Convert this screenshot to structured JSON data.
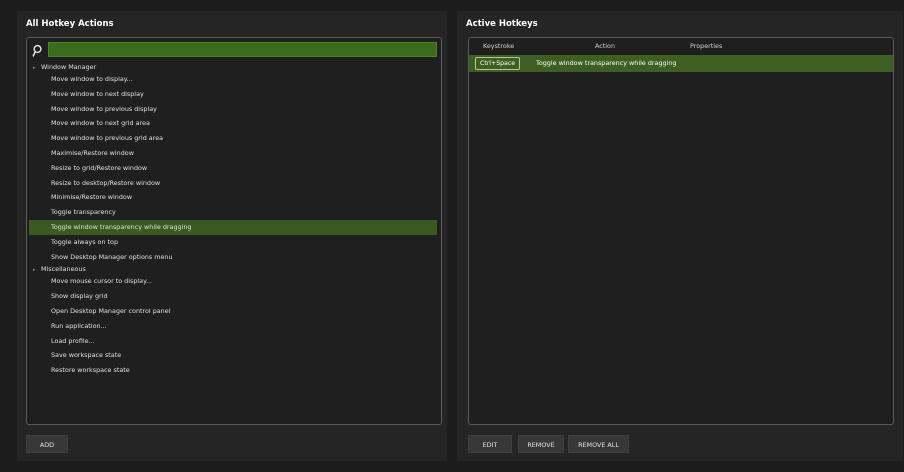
{
  "left_panel": {
    "title": "All Hotkey Actions",
    "groups": [
      {
        "label": "Window Manager",
        "items": [
          "Move window to display...",
          "Move window to next display",
          "Move window to previous display",
          "Move window to next grid area",
          "Move window to previous grid area",
          "Maximise/Restore window",
          "Resize to grid/Restore window",
          "Resize to desktop/Restore window",
          "Minimise/Restore window",
          "Toggle transparency",
          "Toggle window transparency while dragging",
          "Toggle always on top",
          "Show Desktop Manager options menu"
        ]
      },
      {
        "label": "Miscellaneous",
        "items": [
          "Move mouse cursor to display...",
          "Show display grid",
          "Open Desktop Manager control panel",
          "Run application...",
          "Load profile...",
          "Save workspace state",
          "Restore workspace state"
        ]
      }
    ],
    "selected_item": "Toggle window transparency while dragging",
    "add_label": "ADD"
  },
  "right_panel": {
    "title": "Active Hotkeys",
    "columns": [
      "Keystroke",
      "Action",
      "Properties"
    ],
    "rows": [
      {
        "keystroke": "Ctrl+Space",
        "action": "Toggle window transparency while dragging",
        "properties": ""
      }
    ],
    "edit_label": "EDIT",
    "remove_label": "REMOVE",
    "remove_all_label": "REMOVE ALL"
  },
  "icons": {
    "search": "search-icon"
  },
  "colors": {
    "accent": "#3d6b1c",
    "selection": "#3a5a22",
    "background": "#1b1b1b"
  }
}
